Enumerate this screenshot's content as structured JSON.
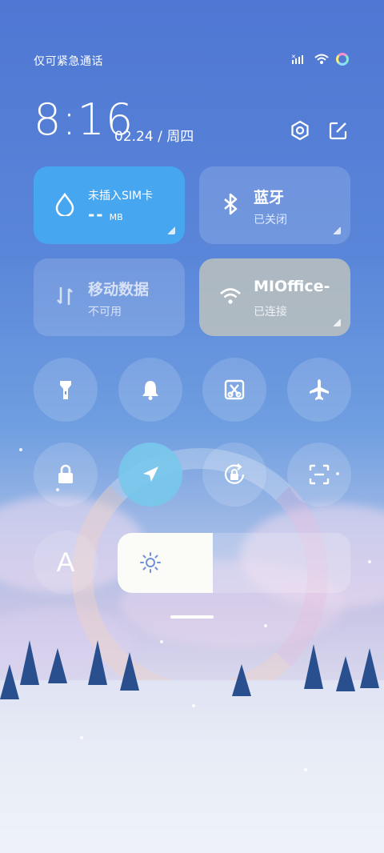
{
  "status_bar": {
    "carrier_text": "仅可紧急通话",
    "icons": [
      "signal-icon",
      "wifi-icon",
      "battery-ring-icon"
    ]
  },
  "header": {
    "time": "8:16",
    "date": "02.24 / 周四",
    "actions": [
      "settings-icon",
      "edit-icon"
    ]
  },
  "tiles": [
    {
      "id": "data-usage",
      "title": "未插入SIM卡",
      "value": "--",
      "unit": "MB",
      "active": true,
      "color": "#47a6f0"
    },
    {
      "id": "bluetooth",
      "title": "蓝牙",
      "subtitle": "已关闭",
      "active": false
    },
    {
      "id": "mobile-data",
      "title": "移动数据",
      "subtitle": "不可用",
      "active": false
    },
    {
      "id": "wifi",
      "title": "MIOffice-",
      "subtitle": "已连接",
      "active": true
    }
  ],
  "toggles_row1": [
    "flashlight-icon",
    "bell-icon",
    "screenshot-icon",
    "airplane-icon"
  ],
  "toggles_row2": [
    "lock-icon",
    "location-icon",
    "rotation-lock-icon",
    "scan-icon"
  ],
  "font_button": "A",
  "brightness": {
    "level": 0.41
  }
}
